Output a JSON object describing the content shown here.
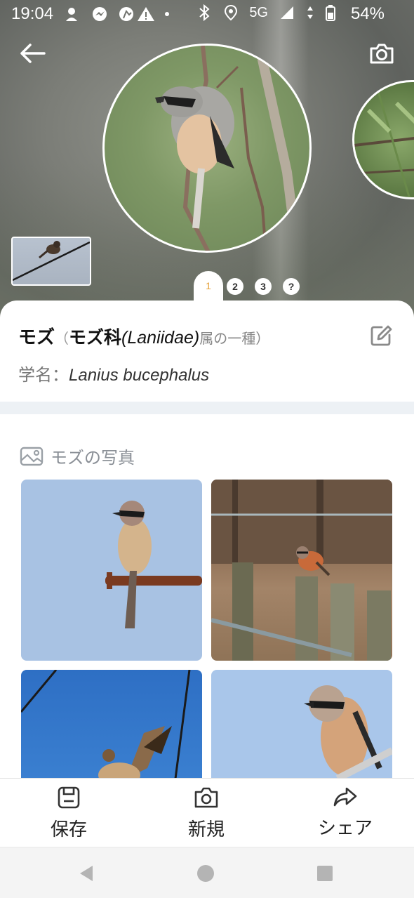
{
  "status_bar": {
    "time": "19:04",
    "network": "5G",
    "battery": "54%"
  },
  "header": {
    "back_icon": "arrow-left-icon",
    "camera_icon": "camera-icon"
  },
  "pager": {
    "pages": [
      "1",
      "2",
      "3",
      "?"
    ],
    "active_index": 0
  },
  "species": {
    "name": "モズ",
    "paren_open": "（",
    "family": "モズ科",
    "family_latin": "(Laniidae)",
    "family_suffix": "属の一種）",
    "scientific_label": "学名：",
    "scientific_name": "Lanius bucephalus"
  },
  "photos": {
    "heading": "モズの写真"
  },
  "actions": {
    "save": "保存",
    "new": "新規",
    "share": "シェア"
  },
  "colors": {
    "accent": "#e6a23c",
    "band": "#edf1f5"
  }
}
